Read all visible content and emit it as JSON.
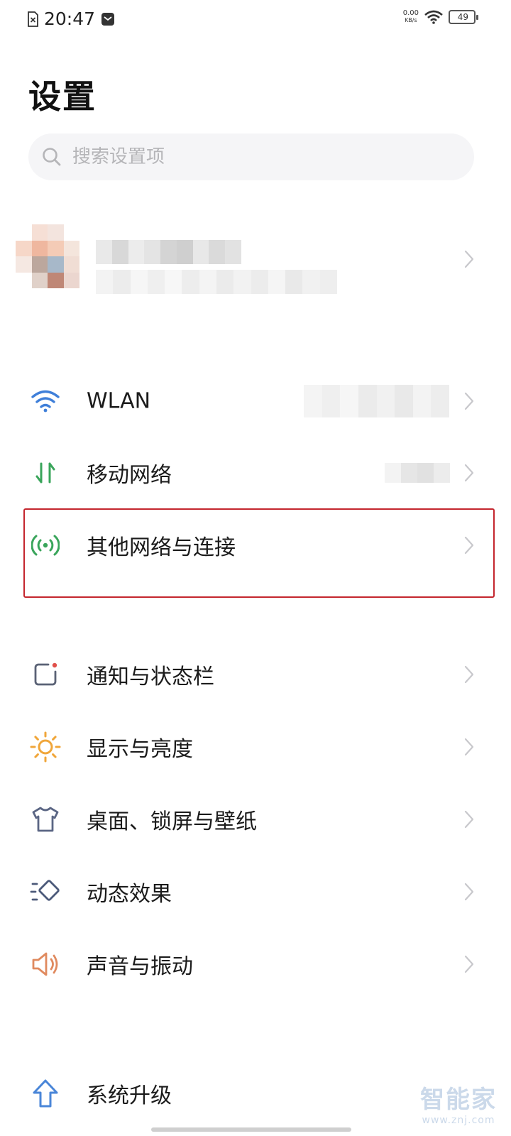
{
  "status_bar": {
    "time": "20:47",
    "net_speed_value": "0.00",
    "net_speed_unit": "KB/s",
    "battery": "49"
  },
  "page": {
    "title": "设置"
  },
  "search": {
    "placeholder": "搜索设置项"
  },
  "settings": {
    "wlan": "WLAN",
    "mobile_network": "移动网络",
    "other_networks": "其他网络与连接",
    "notifications": "通知与状态栏",
    "display": "显示与亮度",
    "desktop": "桌面、锁屏与壁纸",
    "animation": "动态效果",
    "sound": "声音与振动",
    "update": "系统升级"
  },
  "colors": {
    "highlight_border": "#c4262e",
    "wlan_icon": "#3f7fd9",
    "mobile_icon": "#3aa55b",
    "other_net_icon": "#3aa55b",
    "notification_icon": "#5a6275",
    "display_icon": "#f0a63a",
    "desktop_icon": "#5b6684",
    "animation_icon": "#4c5a7a",
    "sound_icon": "#e08a5f",
    "update_icon": "#4a86d8"
  },
  "watermark": {
    "title": "智能家",
    "url": "www.znj.com"
  }
}
